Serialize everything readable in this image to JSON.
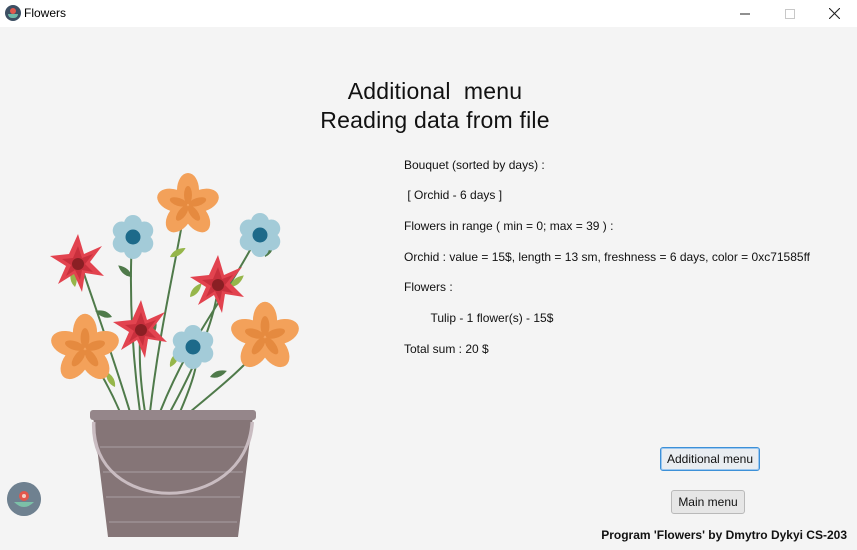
{
  "window": {
    "title": "Flowers",
    "icons": {
      "app": "flower-app-icon",
      "minimize": "minimize-icon",
      "maximize": "maximize-icon",
      "close": "close-icon"
    }
  },
  "headings": {
    "line1": "Additional  menu",
    "line2": "Reading data from file"
  },
  "info": {
    "bouquet_label": "Bouquet (sorted by days) :",
    "bouquet_value": " [ Orchid - 6 days ]",
    "range_label": "Flowers in range ( min = 0; max = 39 ) :",
    "range_value": "Orchid : value = 15$, length = 13 sm, freshness = 6 days, color = 0xc71585ff",
    "flowers_label": "Flowers :",
    "flowers_value": "        Tulip - 1 flower(s) - 15$",
    "total": "Total sum : 20 $"
  },
  "buttons": {
    "additional_menu": "Additional menu",
    "main_menu": "Main menu"
  },
  "credits": "Program 'Flowers' by Dmytro Dykyi CS-203",
  "colors": {
    "background": "#f4f4f4",
    "button_focus_border": "#3c90d8",
    "flower_orange": "#f3a15a",
    "flower_red": "#e2434f",
    "flower_blue": "#9dc6d4",
    "bucket": "#857577"
  }
}
